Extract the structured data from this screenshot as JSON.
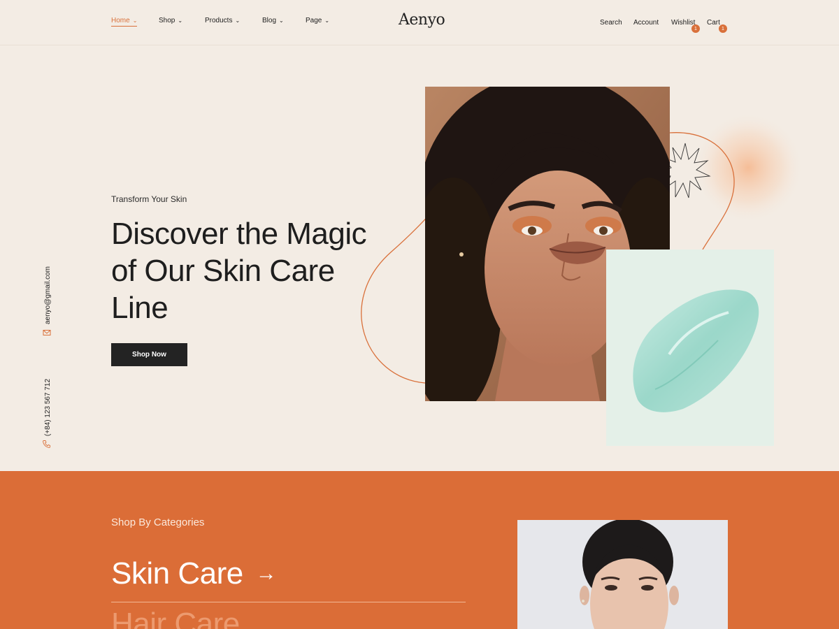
{
  "brand": {
    "logo": "Aenyo"
  },
  "nav": {
    "items": [
      {
        "label": "Home",
        "active": true
      },
      {
        "label": "Shop"
      },
      {
        "label": "Products"
      },
      {
        "label": "Blog"
      },
      {
        "label": "Page"
      }
    ],
    "chevron": "⌄"
  },
  "header_actions": {
    "search": "Search",
    "account": "Account",
    "wishlist": "Wishlist",
    "wishlist_count": "1",
    "cart": "Cart",
    "cart_count": "1"
  },
  "hero": {
    "subtitle": "Transform Your Skin",
    "title_line1": "Discover the Magic",
    "title_line2": "of Our Skin Care",
    "title_line3": "Line",
    "cta": "Shop Now"
  },
  "contact": {
    "email": "aenyo@gmail.com",
    "phone": "(+84) 123 567 712"
  },
  "categories": {
    "heading": "Shop By Categories",
    "items": [
      {
        "label": "Skin Care",
        "arrow": "→"
      },
      {
        "label": "Hair Care"
      }
    ]
  },
  "colors": {
    "accent": "#d9703a",
    "background": "#f3ece4",
    "category_bg": "#db6d37",
    "dark_button": "#232323",
    "gel_card": "#e4f0e8"
  }
}
